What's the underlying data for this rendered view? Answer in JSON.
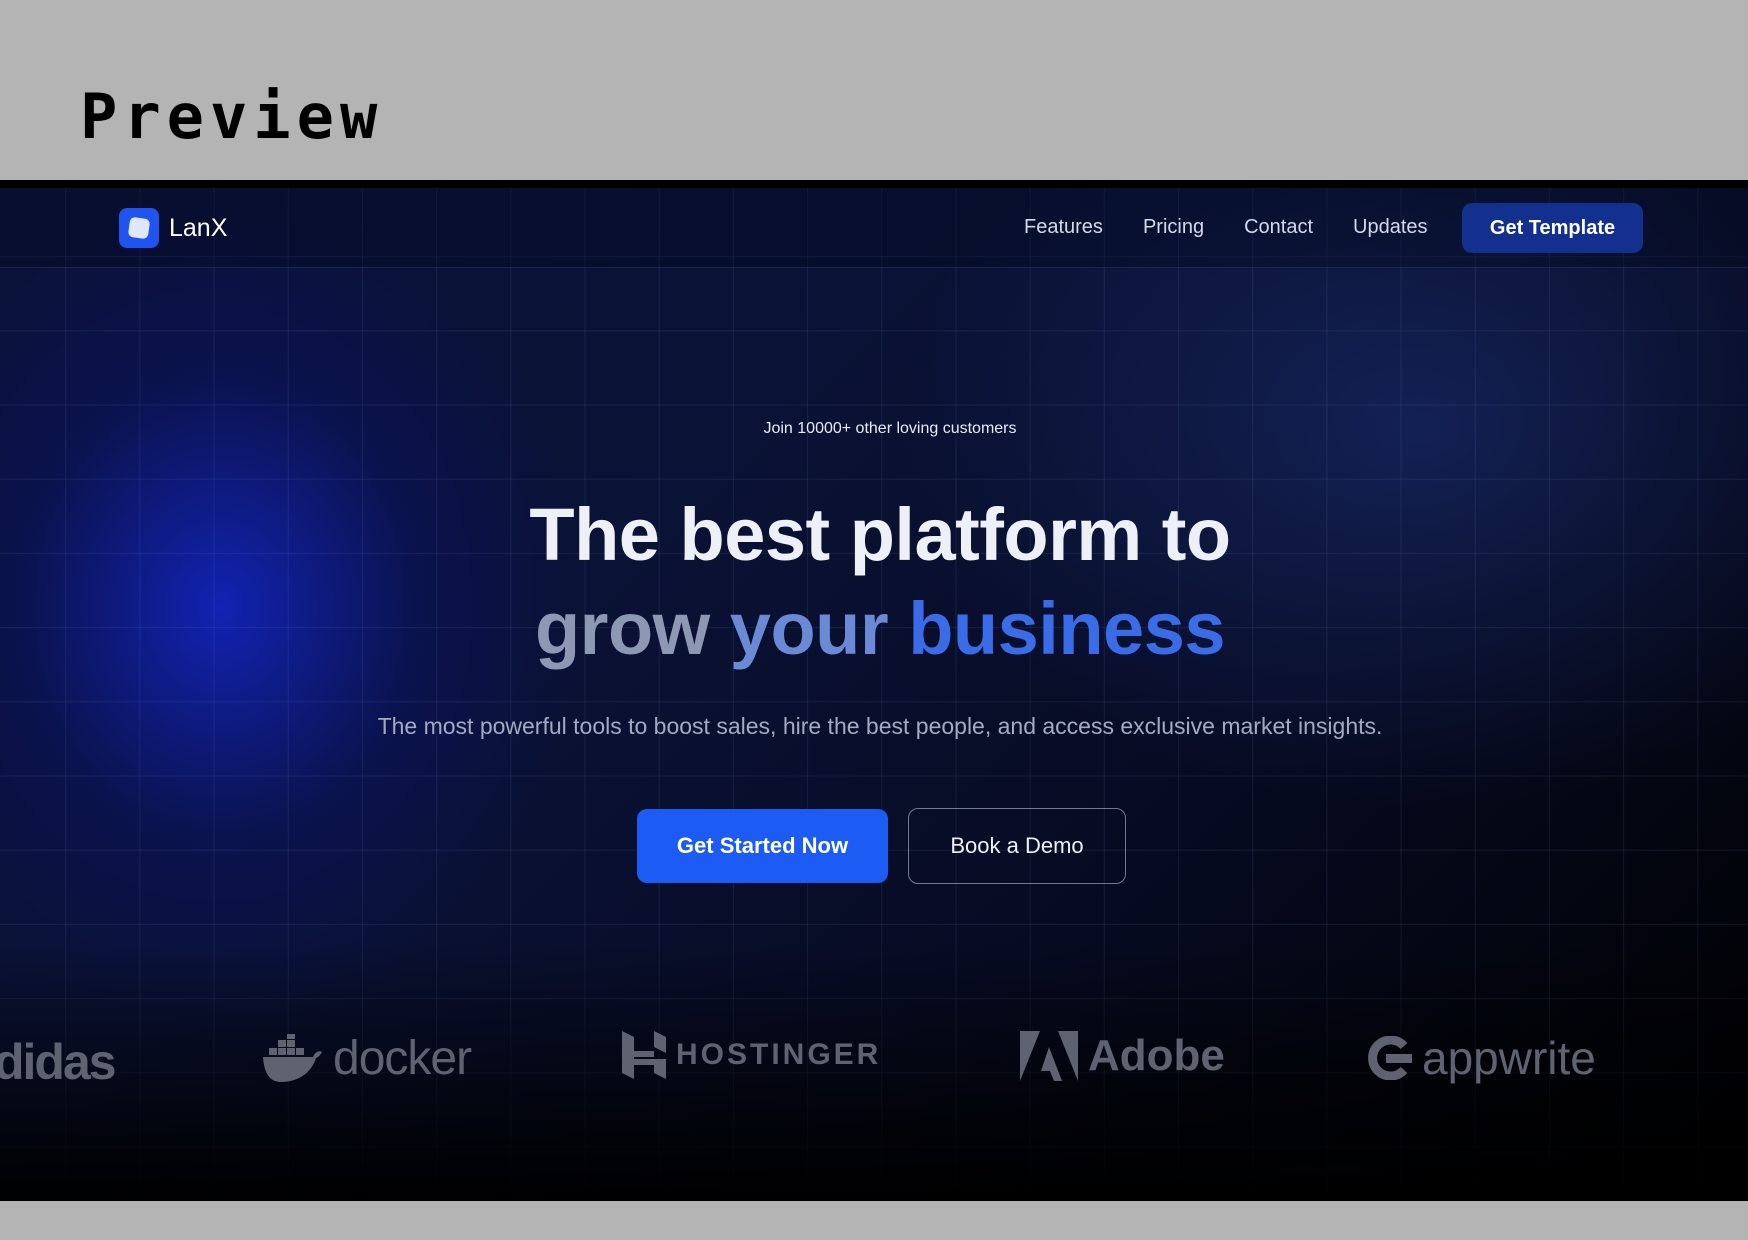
{
  "preview": {
    "title": "Preview"
  },
  "nav": {
    "brand": "LanX",
    "links": [
      "Features",
      "Pricing",
      "Contact",
      "Updates"
    ],
    "cta": "Get Template"
  },
  "hero": {
    "tagline": "Join 10000+ other loving customers",
    "headline_line1": "The best platform to",
    "headline_word1": "grow",
    "headline_word2": "your",
    "headline_word3": "business",
    "subtitle": "The most powerful tools to boost sales, hire the best people, and access exclusive market insights.",
    "primary_button": "Get Started Now",
    "secondary_button": "Book a Demo"
  },
  "partners": {
    "adidas": "didas",
    "docker": "docker",
    "hostinger": "HOSTINGER",
    "adobe": "Adobe",
    "appwrite": "appwrite"
  },
  "colors": {
    "accent": "#1c5cf5",
    "nav_cta_bg": "#14308f",
    "headline_business": "#3a6ce8",
    "background_dark": "#0a1236"
  },
  "icons": {
    "logo": "lanx-logo-icon",
    "docker": "docker-whale-icon",
    "hostinger": "hostinger-h-icon",
    "adobe": "adobe-a-icon",
    "appwrite": "appwrite-icon"
  }
}
